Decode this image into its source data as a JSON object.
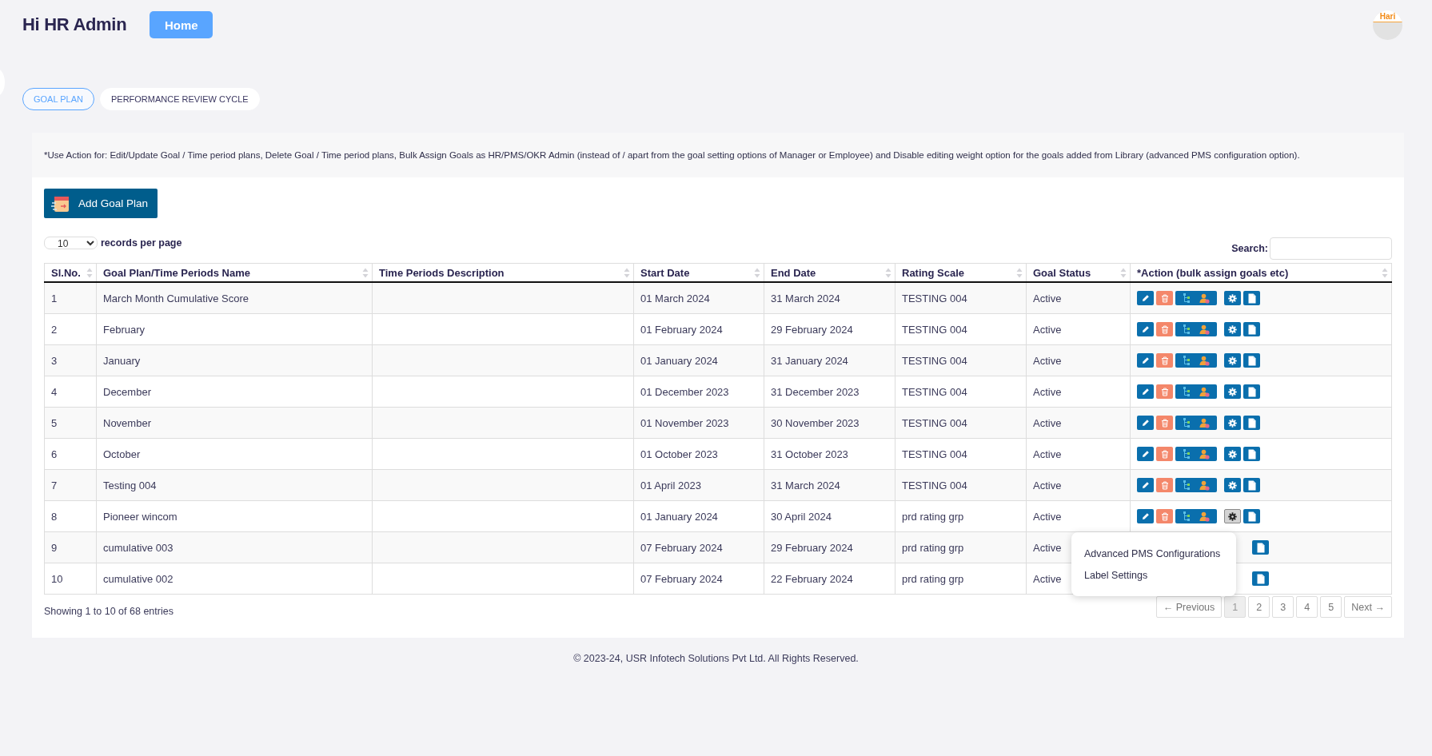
{
  "header": {
    "greeting": "Hi HR Admin",
    "home_button": "Home",
    "avatar_label": "Hari"
  },
  "tabs": [
    {
      "label": "GOAL PLAN",
      "selected": true
    },
    {
      "label": "PERFORMANCE REVIEW CYCLE",
      "selected": false
    }
  ],
  "note": "*Use Action for: Edit/Update Goal / Time period plans, Delete Goal / Time period plans, Bulk Assign Goals as HR/PMS/OKR Admin (instead of / apart from the goal setting options of Manager or Employee) and Disable editing weight option for the goals added from Library (advanced PMS configuration option).",
  "add_button": "Add Goal Plan",
  "page_length": {
    "value": "10",
    "label": "records per page"
  },
  "search": {
    "label": "Search:"
  },
  "table": {
    "columns": [
      "Sl.No.",
      "Goal Plan/Time Periods Name",
      "Time Periods Description",
      "Start Date",
      "End Date",
      "Rating Scale",
      "Goal Status",
      "*Action (bulk assign goals etc)"
    ],
    "rows": [
      {
        "sl": "1",
        "name": "March Month Cumulative Score",
        "start": "01 March 2024",
        "end": "31 March 2024",
        "rating": "TESTING 004",
        "status": "Active",
        "settings_open": false
      },
      {
        "sl": "2",
        "name": "February",
        "start": "01 February 2024",
        "end": "29 February 2024",
        "rating": "TESTING 004",
        "status": "Active",
        "settings_open": false
      },
      {
        "sl": "3",
        "name": "January",
        "start": "01 January 2024",
        "end": "31 January 2024",
        "rating": "TESTING 004",
        "status": "Active",
        "settings_open": false
      },
      {
        "sl": "4",
        "name": "December",
        "start": "01 December 2023",
        "end": "31 December 2023",
        "rating": "TESTING 004",
        "status": "Active",
        "settings_open": false
      },
      {
        "sl": "5",
        "name": "November",
        "start": "01 November 2023",
        "end": "30 November 2023",
        "rating": "TESTING 004",
        "status": "Active",
        "settings_open": false
      },
      {
        "sl": "6",
        "name": "October",
        "start": "01 October 2023",
        "end": "31 October 2023",
        "rating": "TESTING 004",
        "status": "Active",
        "settings_open": false
      },
      {
        "sl": "7",
        "name": "Testing 004",
        "start": "01 April 2023",
        "end": "31 March 2024",
        "rating": "TESTING 004",
        "status": "Active",
        "settings_open": false
      },
      {
        "sl": "8",
        "name": "Pioneer wincom",
        "start": "01 January 2024",
        "end": "30 April 2024",
        "rating": "prd rating grp",
        "status": "Active",
        "settings_open": true
      },
      {
        "sl": "9",
        "name": "cumulative 003",
        "start": "07 February 2024",
        "end": "29 February 2024",
        "rating": "prd rating grp",
        "status": "Active",
        "settings_open": false
      },
      {
        "sl": "10",
        "name": "cumulative 002",
        "start": "07 February 2024",
        "end": "22 February 2024",
        "rating": "prd rating grp",
        "status": "Active",
        "settings_open": false
      }
    ]
  },
  "settings_menu": [
    "Advanced PMS Configurations",
    "Label Settings"
  ],
  "info": "Showing 1 to 10 of 68 entries",
  "pagination": [
    {
      "label": "← Previous",
      "selected": false
    },
    {
      "label": "1",
      "selected": true
    },
    {
      "label": "2",
      "selected": false
    },
    {
      "label": "3",
      "selected": false
    },
    {
      "label": "4",
      "selected": false
    },
    {
      "label": "5",
      "selected": false
    },
    {
      "label": "Next →",
      "selected": false
    }
  ],
  "footer": "© 2023-24, USR Infotech Solutions Pvt Ltd. All Rights Reserved."
}
